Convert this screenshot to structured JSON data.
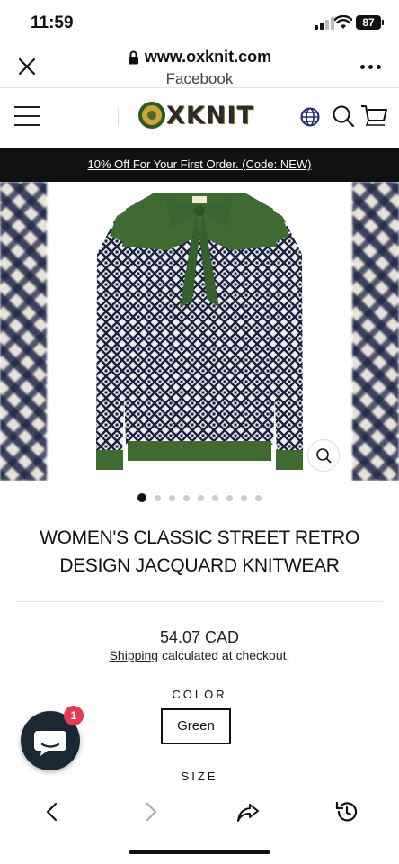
{
  "status_bar": {
    "time": "11:59",
    "battery": "87"
  },
  "browser": {
    "url": "www.oxknit.com",
    "subtitle": "Facebook"
  },
  "header": {
    "logo_text": "XKNIT"
  },
  "promo": {
    "text": "10% Off For Your First Order. (Code: NEW)"
  },
  "gallery": {
    "image_count": 9,
    "active_index": 0
  },
  "product": {
    "title": "WOMEN'S CLASSIC STREET RETRO DESIGN JACQUARD KNITWEAR",
    "price": "54.07 CAD",
    "shipping_link": "Shipping",
    "shipping_rest": " calculated at checkout.",
    "color_label": "COLOR",
    "color_value": "Green",
    "size_label": "SIZE"
  },
  "chat": {
    "badge": "1"
  },
  "colors": {
    "sweater_green": "#3f6b33",
    "promo_bg": "#111111",
    "chat_bg": "#1a2836",
    "badge": "#e53a52"
  }
}
